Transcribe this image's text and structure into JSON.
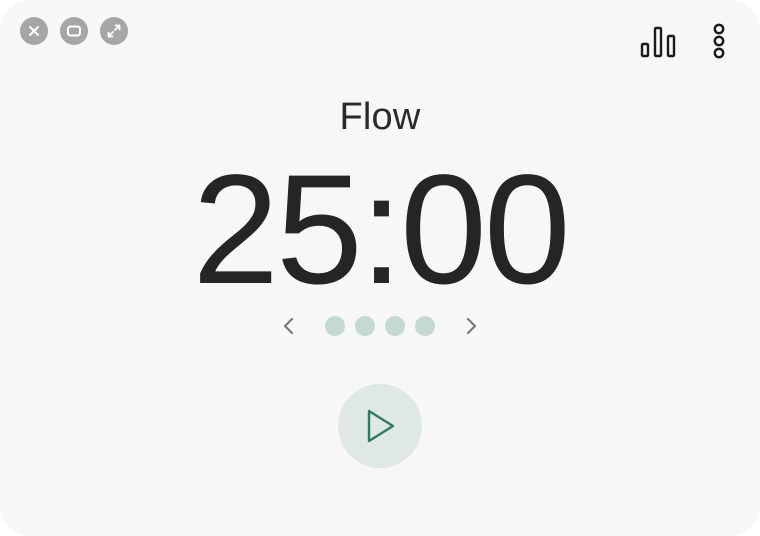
{
  "window": {
    "controls": [
      {
        "name": "close",
        "icon": "close-icon"
      },
      {
        "name": "minimize",
        "icon": "minimize-icon"
      },
      {
        "name": "fullscreen",
        "icon": "expand-icon"
      }
    ]
  },
  "toolbar": {
    "stats_icon": "bar-chart-icon",
    "menu_icon": "more-vertical-icon"
  },
  "session": {
    "label": "Flow",
    "time": "25:00",
    "dots_total": 4,
    "dots_completed": 0
  },
  "controls": {
    "play_icon": "play-icon"
  },
  "colors": {
    "background": "#f7f7f7",
    "accent": "#2f7a63",
    "dot": "#c4d9d3",
    "play_bg": "#dfe8e5",
    "window_control": "#a6a6a6"
  }
}
